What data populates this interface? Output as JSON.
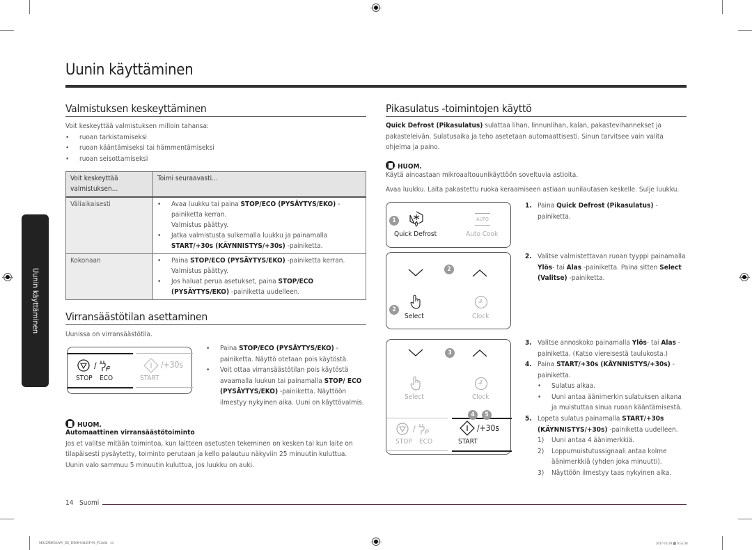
{
  "page": {
    "title": "Uunin käyttäminen",
    "side_tab": "Uunin käyttäminen",
    "page_number": "14",
    "language": "Suomi",
    "slug_file": "MS22M8054AW_EE_DE68-04445F-01_FI.indd   14",
    "slug_date": "2017-11-29",
    "slug_time": "6:55:38"
  },
  "pause": {
    "heading": "Valmistuksen keskeyttäminen",
    "intro": "Voit keskeyttää valmistuksen milloin tahansa:",
    "bullets": [
      "ruoan tarkistamiseksi",
      "ruoan kääntämiseksi tai hämmentämiseksi",
      "ruoan seisottamiseksi"
    ],
    "table": {
      "headers": [
        "Voit keskeyttää valmistuksen...",
        "Toimi seuraavasti..."
      ],
      "rows": [
        {
          "when": "Väliaikaisesti",
          "items": [
            {
              "pre": "Avaa luukku tai paina ",
              "bold": "STOP/ECO (PYSÄYTYS/EKO)",
              "post": " -painiketta kerran.",
              "extra": "Valmistus päättyy."
            },
            {
              "pre": "Jatka valmistusta sulkemalla luukku ja painamalla ",
              "bold": "START/+30s (KÄYNNISTYS/+30s)",
              "post": " -painiketta.",
              "extra": ""
            }
          ]
        },
        {
          "when": "Kokonaan",
          "items": [
            {
              "pre": "Paina ",
              "bold": "STOP/ECO (PYSÄYTYS/EKO)",
              "post": " -painiketta kerran.",
              "extra": "Valmistus päättyy."
            },
            {
              "pre": "Jos haluat perua asetukset, paina ",
              "bold": "STOP/ECO (PYSÄYTYS/EKO)",
              "post": " -painiketta uudelleen.",
              "extra": ""
            }
          ]
        }
      ]
    }
  },
  "eco": {
    "heading": "Virransäästötilan asettaminen",
    "intro": "Uunissa on virransäästötila.",
    "panel": {
      "stop": "STOP",
      "eco": "ECO",
      "start": "START",
      "plus30": "/+30s",
      "slash": "/"
    },
    "bullets": [
      {
        "pre": "Paina ",
        "bold": "STOP/ECO (PYSÄYTYS/EKO)",
        "post": " -painiketta. Näyttö otetaan pois käytöstä."
      },
      {
        "pre": "Voit ottaa virransäästötilan pois käytöstä avaamalla luukun tai painamalla ",
        "bold": "STOP/ ECO (PYSÄYTYS/EKO)",
        "post": " -painiketta. Näyttöön ilmestyy nykyinen aika. Uuni on käyttövalmis."
      }
    ],
    "note_label": "HUOM.",
    "note_title": "Automaattinen virransäästötoiminto",
    "note_text": "Jos et valitse mitään toimintoa, kun laitteen asetusten tekeminen on kesken tai kun laite on tilapäisesti pysäytetty, toiminto perutaan ja kello palautuu näkyviin 25 minuutin kuluttua. Uunin valo sammuu 5 minuutin kuluttua, jos luukku on auki."
  },
  "defrost": {
    "heading": "Pikasulatus -toimintojen käyttö",
    "intro_bold": "Quick Defrost (Pikasulatus)",
    "intro_rest": " sulattaa lihan, linnunlihan, kalan, pakastevihannekset ja pakasteleivän. Sulatusaika ja teho asetetaan automaattisesti. Sinun tarvitsee vain valita ohjelma ja paino.",
    "note_label": "HUOM.",
    "note_text": "Käytä ainoastaan mikroaaltouunikäyttöön soveltuvia astioita.",
    "prep": "Avaa luukku. Laita pakastettu ruoka keraamiseen astiaan uunilautasen keskelle. Sulje luukku.",
    "panels": {
      "quick_defrost": "Quick Defrost",
      "auto_cook": "Auto Cook",
      "auto_glyph": "AUTO",
      "select": "Select",
      "clock": "Clock",
      "stop": "STOP",
      "eco": "ECO",
      "start": "START",
      "plus30": "/+30s",
      "slash": "/",
      "badges": [
        "1",
        "2",
        "2",
        "3",
        "4",
        "5"
      ]
    },
    "steps": [
      {
        "num": "1.",
        "parts": [
          [
            "",
            "Paina "
          ],
          [
            "b",
            "Quick Defrost (Pikasulatus)"
          ],
          [
            "",
            " -painiketta."
          ]
        ]
      },
      {
        "num": "2.",
        "parts": [
          [
            "",
            "Valitse valmistettavan ruoan tyyppi painamalla "
          ],
          [
            "b",
            "Ylös"
          ],
          [
            "",
            "- tai "
          ],
          [
            "b",
            "Alas"
          ],
          [
            "",
            " -painiketta. Paina sitten "
          ],
          [
            "b",
            "Select (Valitse)"
          ],
          [
            "",
            " -painiketta."
          ]
        ]
      },
      {
        "num": "3.",
        "parts": [
          [
            "",
            "Valitse annoskoko painamalla "
          ],
          [
            "b",
            "Ylös"
          ],
          [
            "",
            "- tai "
          ],
          [
            "b",
            "Alas"
          ],
          [
            "",
            " -painiketta. (Katso viereisestä taulukosta.)"
          ]
        ]
      },
      {
        "num": "4.",
        "parts": [
          [
            "",
            "Paina "
          ],
          [
            "b",
            "START/+30s (KÄYNNISTYS/+30s)"
          ],
          [
            "",
            " -painiketta."
          ]
        ]
      },
      {
        "num": "5.",
        "parts": [
          [
            "",
            "Lopeta sulatus painamalla "
          ],
          [
            "b",
            "START/+30s (KÄYNNISTYS/+30s)"
          ],
          [
            "",
            " -painiketta uudelleen."
          ]
        ]
      }
    ],
    "step4_bullets": [
      "Sulatus alkaa.",
      "Uuni antaa äänimerkin sulatuksen aikana ja muistuttaa sinua ruoan kääntämisestä."
    ],
    "step5_sub": [
      {
        "n": "1)",
        "text": "Uuni antaa 4 äänimerkkiä."
      },
      {
        "n": "2)",
        "text": "Loppumuistutussignaali antaa kolme äänimerkkiä (yhden joka minuutti)."
      },
      {
        "n": "3)",
        "text": "Näyttöön ilmestyy taas nykyinen aika."
      }
    ]
  }
}
